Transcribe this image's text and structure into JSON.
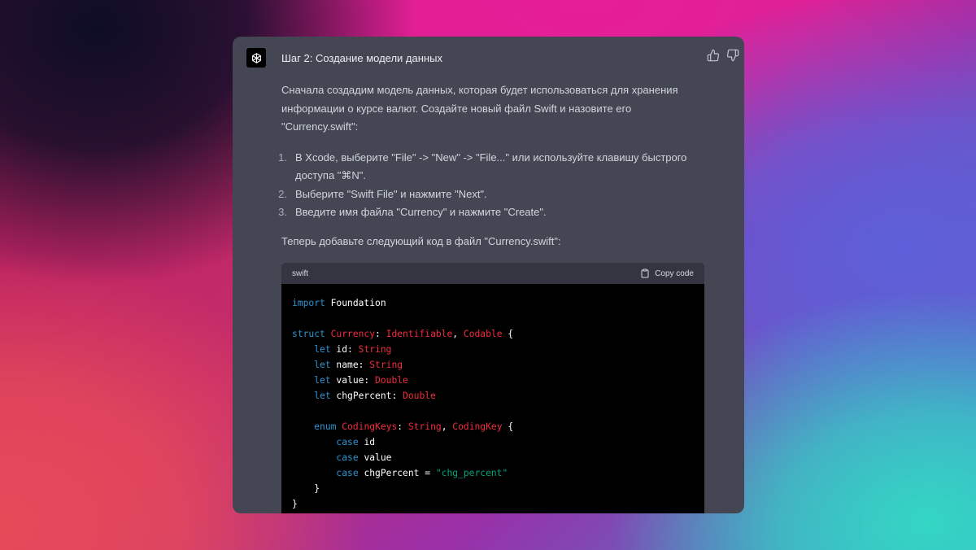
{
  "message": {
    "step_title": "Шаг 2: Создание модели данных",
    "intro": "Сначала создадим модель данных, которая будет использоваться для хранения информации о курсе валют. Создайте новый файл Swift и назовите его \"Currency.swift\":",
    "steps": [
      {
        "num": "1.",
        "text": "В Xcode, выберите \"File\" -> \"New\" -> \"File...\" или используйте клавишу быстрого доступа \"⌘N\"."
      },
      {
        "num": "2.",
        "text": "Выберите \"Swift File\" и нажмите \"Next\"."
      },
      {
        "num": "3.",
        "text": "Введите имя файла \"Currency\" и нажмите \"Create\"."
      }
    ],
    "code_intro": "Теперь добавьте следующий код в файл \"Currency.swift\":"
  },
  "code_block": {
    "language": "swift",
    "copy_label": "Copy code",
    "lines": [
      [
        [
          "kw",
          "import"
        ],
        [
          "pl",
          " Foundation"
        ]
      ],
      [],
      [
        [
          "kw",
          "struct"
        ],
        [
          "pl",
          " "
        ],
        [
          "ty",
          "Currency"
        ],
        [
          "pl",
          ": "
        ],
        [
          "ty",
          "Identifiable"
        ],
        [
          "pl",
          ", "
        ],
        [
          "ty",
          "Codable"
        ],
        [
          "pl",
          " {"
        ]
      ],
      [
        [
          "pl",
          "    "
        ],
        [
          "kw",
          "let"
        ],
        [
          "pl",
          " id: "
        ],
        [
          "ty",
          "String"
        ]
      ],
      [
        [
          "pl",
          "    "
        ],
        [
          "kw",
          "let"
        ],
        [
          "pl",
          " name: "
        ],
        [
          "ty",
          "String"
        ]
      ],
      [
        [
          "pl",
          "    "
        ],
        [
          "kw",
          "let"
        ],
        [
          "pl",
          " value: "
        ],
        [
          "ty",
          "Double"
        ]
      ],
      [
        [
          "pl",
          "    "
        ],
        [
          "kw",
          "let"
        ],
        [
          "pl",
          " chgPercent: "
        ],
        [
          "ty",
          "Double"
        ]
      ],
      [],
      [
        [
          "pl",
          "    "
        ],
        [
          "kw",
          "enum"
        ],
        [
          "pl",
          " "
        ],
        [
          "ty",
          "CodingKeys"
        ],
        [
          "pl",
          ": "
        ],
        [
          "ty",
          "String"
        ],
        [
          "pl",
          ", "
        ],
        [
          "ty",
          "CodingKey"
        ],
        [
          "pl",
          " {"
        ]
      ],
      [
        [
          "pl",
          "        "
        ],
        [
          "kw",
          "case"
        ],
        [
          "pl",
          " id"
        ]
      ],
      [
        [
          "pl",
          "        "
        ],
        [
          "kw",
          "case"
        ],
        [
          "pl",
          " value"
        ]
      ],
      [
        [
          "pl",
          "        "
        ],
        [
          "kw",
          "case"
        ],
        [
          "pl",
          " chgPercent = "
        ],
        [
          "st",
          "\"chg_percent\""
        ]
      ],
      [
        [
          "pl",
          "    }"
        ]
      ],
      [
        [
          "pl",
          "}"
        ]
      ]
    ]
  },
  "icons": {
    "avatar": "openai-logo-icon",
    "like": "thumbs-up-icon",
    "dislike": "thumbs-down-icon",
    "copy": "clipboard-icon"
  },
  "colors": {
    "card_bg": "#444654",
    "code_header_bg": "#343541",
    "code_bg": "#000000",
    "keyword": "#2e95d3",
    "type": "#f22c3d",
    "string": "#00a67d"
  }
}
